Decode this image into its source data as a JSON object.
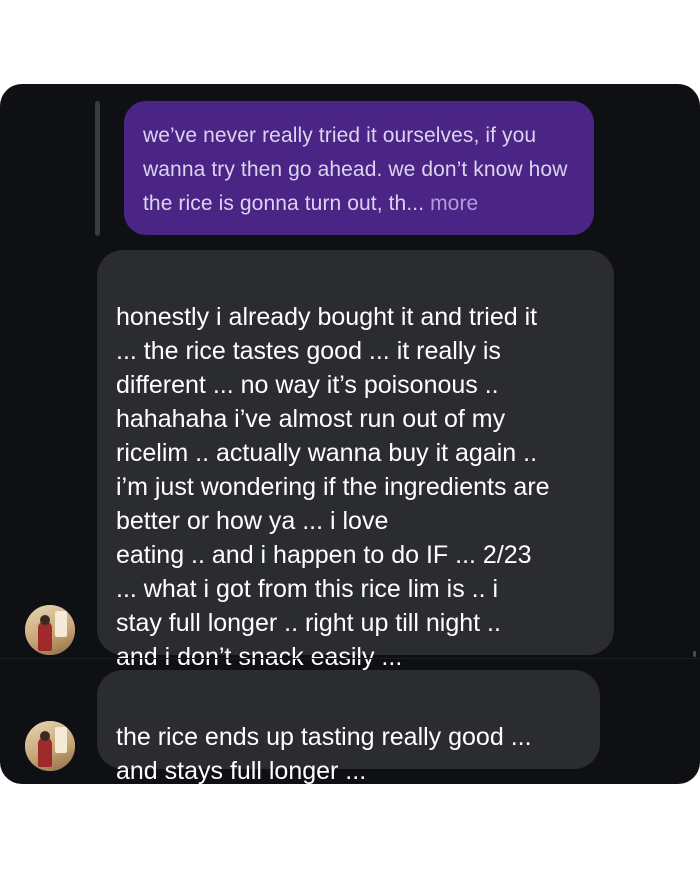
{
  "conversation": {
    "quoted_reply": {
      "text": "we’ve never really tried it ourselves, if you wanna try then go ahead. we don’t know how the rice is gonna turn out, th...",
      "more_label": "more"
    },
    "messages": [
      {
        "sender": "other",
        "text": "honestly i already bought it and tried it\n... the rice tastes good ... it really is\ndifferent ... no way it’s poisonous ..\nhahahaha i’ve almost run out of my\nricelim .. actually wanna buy it again ..\ni’m just wondering if the ingredients are\nbetter or how ya ... i love\neating .. and i happen to do IF ... 2/23\n... what i got from this rice lim is .. i\nstay full longer .. right up till night ..\nand i don’t snack easily ..."
      },
      {
        "sender": "other",
        "text": "the rice ends up tasting really good ...\nand stays full longer ..."
      }
    ]
  },
  "colors": {
    "background": "#0f1013",
    "outgoing_bubble": "#4a2586",
    "incoming_bubble": "#2b2c30"
  }
}
